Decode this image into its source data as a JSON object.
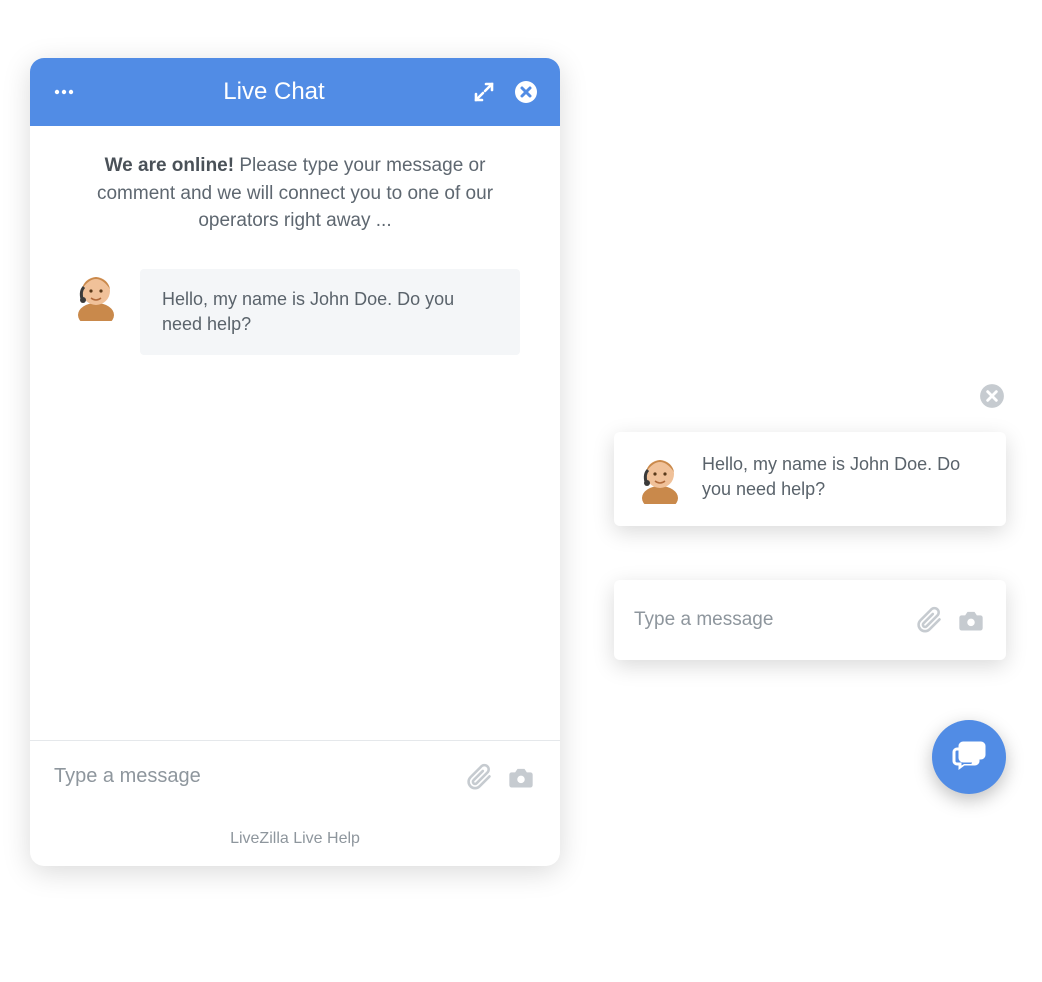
{
  "header": {
    "title": "Live Chat"
  },
  "welcome": {
    "bold": "We are online!",
    "text": " Please type your message or comment and we will connect you to one of our operators right away ..."
  },
  "operator_message": "Hello, my name is John Doe. Do you need help?",
  "input": {
    "placeholder": "Type a message"
  },
  "footer": {
    "brand": "LiveZilla Live Help"
  },
  "toast": {
    "message": "Hello, my name is John Doe. Do you need help?"
  },
  "mini_input": {
    "placeholder": "Type a message"
  },
  "colors": {
    "accent": "#518ce5",
    "icon_muted": "#c6cbd0",
    "text": "#5e6770",
    "bubble_bg": "#f4f6f8"
  }
}
